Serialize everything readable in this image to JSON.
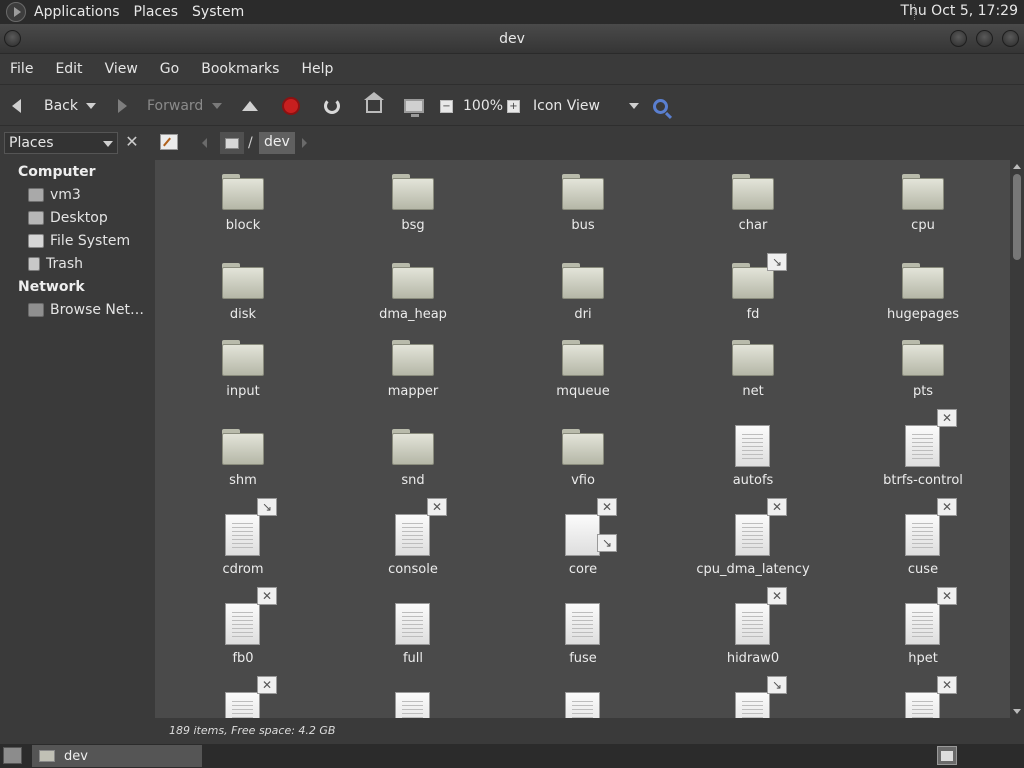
{
  "top_panel": {
    "menus": [
      "Applications",
      "Places",
      "System"
    ],
    "clock": "Thu Oct  5, 17:29"
  },
  "window": {
    "title": "dev"
  },
  "menubar": [
    "File",
    "Edit",
    "View",
    "Go",
    "Bookmarks",
    "Help"
  ],
  "toolbar": {
    "back_label": "Back",
    "forward_label": "Forward",
    "zoom_level": "100%",
    "view_mode": "Icon View"
  },
  "sidebar": {
    "pane_title": "Places",
    "sections": [
      {
        "heading": "Computer",
        "items": [
          {
            "label": "vm3",
            "icon": "home-icon"
          },
          {
            "label": "Desktop",
            "icon": "desktop-icon"
          },
          {
            "label": "File System",
            "icon": "filesystem-icon"
          },
          {
            "label": "Trash",
            "icon": "trash-icon"
          }
        ]
      },
      {
        "heading": "Network",
        "items": [
          {
            "label": "Browse Net…",
            "icon": "network-icon"
          }
        ]
      }
    ]
  },
  "location": {
    "root": "/",
    "current": "dev"
  },
  "files": [
    {
      "name": "block",
      "type": "folder",
      "emblem": ""
    },
    {
      "name": "bsg",
      "type": "folder",
      "emblem": ""
    },
    {
      "name": "bus",
      "type": "folder",
      "emblem": ""
    },
    {
      "name": "char",
      "type": "folder",
      "emblem": ""
    },
    {
      "name": "cpu",
      "type": "folder",
      "emblem": ""
    },
    {
      "name": "disk",
      "type": "folder",
      "emblem": ""
    },
    {
      "name": "dma_heap",
      "type": "folder",
      "emblem": ""
    },
    {
      "name": "dri",
      "type": "folder",
      "emblem": ""
    },
    {
      "name": "fd",
      "type": "folder",
      "emblem": "link"
    },
    {
      "name": "hugepages",
      "type": "folder",
      "emblem": ""
    },
    {
      "name": "input",
      "type": "folder",
      "emblem": ""
    },
    {
      "name": "mapper",
      "type": "folder",
      "emblem": ""
    },
    {
      "name": "mqueue",
      "type": "folder",
      "emblem": ""
    },
    {
      "name": "net",
      "type": "folder",
      "emblem": ""
    },
    {
      "name": "pts",
      "type": "folder",
      "emblem": ""
    },
    {
      "name": "shm",
      "type": "folder",
      "emblem": ""
    },
    {
      "name": "snd",
      "type": "folder",
      "emblem": ""
    },
    {
      "name": "vfio",
      "type": "folder",
      "emblem": ""
    },
    {
      "name": "autofs",
      "type": "document",
      "emblem": ""
    },
    {
      "name": "btrfs-control",
      "type": "document",
      "emblem": "readonly"
    },
    {
      "name": "cdrom",
      "type": "document",
      "emblem": "link"
    },
    {
      "name": "console",
      "type": "document",
      "emblem": "readonly"
    },
    {
      "name": "core",
      "type": "blank",
      "emblem": "readonly+link"
    },
    {
      "name": "cpu_dma_latency",
      "type": "document",
      "emblem": "readonly"
    },
    {
      "name": "cuse",
      "type": "document",
      "emblem": "readonly"
    },
    {
      "name": "fb0",
      "type": "document",
      "emblem": "readonly"
    },
    {
      "name": "full",
      "type": "document",
      "emblem": ""
    },
    {
      "name": "fuse",
      "type": "document",
      "emblem": ""
    },
    {
      "name": "hidraw0",
      "type": "document",
      "emblem": "readonly"
    },
    {
      "name": "hpet",
      "type": "document",
      "emblem": "readonly"
    },
    {
      "name": "",
      "type": "document",
      "emblem": "readonly"
    },
    {
      "name": "",
      "type": "document",
      "emblem": ""
    },
    {
      "name": "",
      "type": "document",
      "emblem": ""
    },
    {
      "name": "",
      "type": "document",
      "emblem": "link"
    },
    {
      "name": "",
      "type": "document",
      "emblem": "readonly"
    }
  ],
  "status": "189 items, Free space: 4.2 GB",
  "bottom_panel": {
    "task_label": "dev"
  }
}
